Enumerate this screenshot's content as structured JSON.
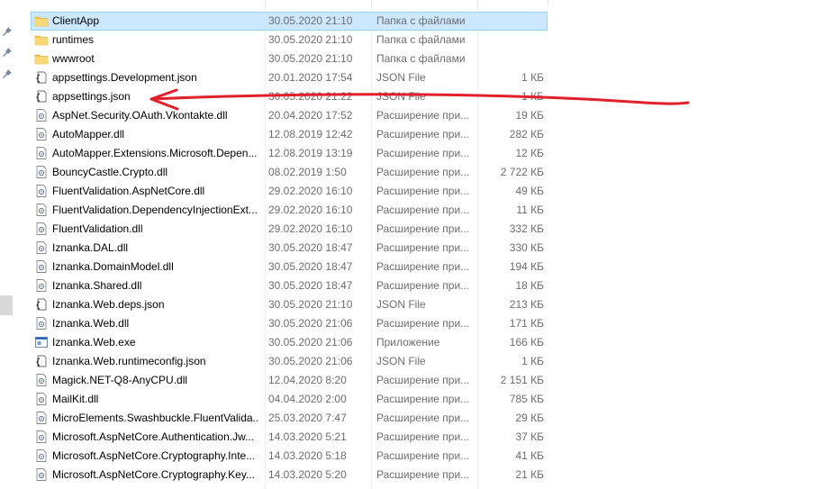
{
  "colors": {
    "selection": "#cce8ff",
    "annotation": "#e0202a",
    "folder": "#f4c63d"
  },
  "files": [
    {
      "name": "ClientApp",
      "date": "30.05.2020 21:10",
      "type": "Папка с файлами",
      "size": "",
      "icon": "folder-icon",
      "selected": true
    },
    {
      "name": "runtimes",
      "date": "30.05.2020 21:10",
      "type": "Папка с файлами",
      "size": "",
      "icon": "folder-icon"
    },
    {
      "name": "wwwroot",
      "date": "30.05.2020 21:10",
      "type": "Папка с файлами",
      "size": "",
      "icon": "folder-icon"
    },
    {
      "name": "appsettings.Development.json",
      "date": "20.01.2020 17:54",
      "type": "JSON File",
      "size": "1 КБ",
      "icon": "json-file-icon"
    },
    {
      "name": "appsettings.json",
      "date": "30.05.2020 21:22",
      "type": "JSON File",
      "size": "1 КБ",
      "icon": "json-file-icon"
    },
    {
      "name": "AspNet.Security.OAuth.Vkontakte.dll",
      "date": "20.04.2020 17:52",
      "type": "Расширение при...",
      "size": "19 КБ",
      "icon": "dll-file-icon"
    },
    {
      "name": "AutoMapper.dll",
      "date": "12.08.2019 12:42",
      "type": "Расширение при...",
      "size": "282 КБ",
      "icon": "dll-file-icon"
    },
    {
      "name": "AutoMapper.Extensions.Microsoft.Depen...",
      "date": "12.08.2019 13:19",
      "type": "Расширение при...",
      "size": "12 КБ",
      "icon": "dll-file-icon"
    },
    {
      "name": "BouncyCastle.Crypto.dll",
      "date": "08.02.2019 1:50",
      "type": "Расширение при...",
      "size": "2 722 КБ",
      "icon": "dll-file-icon"
    },
    {
      "name": "FluentValidation.AspNetCore.dll",
      "date": "29.02.2020 16:10",
      "type": "Расширение при...",
      "size": "49 КБ",
      "icon": "dll-file-icon"
    },
    {
      "name": "FluentValidation.DependencyInjectionExt...",
      "date": "29.02.2020 16:10",
      "type": "Расширение при...",
      "size": "11 КБ",
      "icon": "dll-file-icon"
    },
    {
      "name": "FluentValidation.dll",
      "date": "29.02.2020 16:10",
      "type": "Расширение при...",
      "size": "332 КБ",
      "icon": "dll-file-icon"
    },
    {
      "name": "Iznanka.DAL.dll",
      "date": "30.05.2020 18:47",
      "type": "Расширение при...",
      "size": "330 КБ",
      "icon": "dll-file-icon"
    },
    {
      "name": "Iznanka.DomainModel.dll",
      "date": "30.05.2020 18:47",
      "type": "Расширение при...",
      "size": "194 КБ",
      "icon": "dll-file-icon"
    },
    {
      "name": "Iznanka.Shared.dll",
      "date": "30.05.2020 18:47",
      "type": "Расширение при...",
      "size": "18 КБ",
      "icon": "dll-file-icon"
    },
    {
      "name": "Iznanka.Web.deps.json",
      "date": "30.05.2020 21:10",
      "type": "JSON File",
      "size": "213 КБ",
      "icon": "json-file-icon"
    },
    {
      "name": "Iznanka.Web.dll",
      "date": "30.05.2020 21:06",
      "type": "Расширение при...",
      "size": "171 КБ",
      "icon": "dll-file-icon"
    },
    {
      "name": "Iznanka.Web.exe",
      "date": "30.05.2020 21:06",
      "type": "Приложение",
      "size": "166 КБ",
      "icon": "exe-file-icon"
    },
    {
      "name": "Iznanka.Web.runtimeconfig.json",
      "date": "30.05.2020 21:06",
      "type": "JSON File",
      "size": "1 КБ",
      "icon": "json-file-icon"
    },
    {
      "name": "Magick.NET-Q8-AnyCPU.dll",
      "date": "12.04.2020 8:20",
      "type": "Расширение при...",
      "size": "2 151 КБ",
      "icon": "dll-file-icon"
    },
    {
      "name": "MailKit.dll",
      "date": "04.04.2020 2:00",
      "type": "Расширение при...",
      "size": "785 КБ",
      "icon": "dll-file-icon"
    },
    {
      "name": "MicroElements.Swashbuckle.FluentValida...",
      "date": "25.03.2020 7:47",
      "type": "Расширение при...",
      "size": "29 КБ",
      "icon": "dll-file-icon"
    },
    {
      "name": "Microsoft.AspNetCore.Authentication.Jw...",
      "date": "14.03.2020 5:21",
      "type": "Расширение при...",
      "size": "37 КБ",
      "icon": "dll-file-icon"
    },
    {
      "name": "Microsoft.AspNetCore.Cryptography.Inte...",
      "date": "14.03.2020 5:18",
      "type": "Расширение при...",
      "size": "41 КБ",
      "icon": "dll-file-icon"
    },
    {
      "name": "Microsoft.AspNetCore.Cryptography.Key...",
      "date": "14.03.2020 5:20",
      "type": "Расширение при...",
      "size": "21 КБ",
      "icon": "dll-file-icon"
    }
  ]
}
